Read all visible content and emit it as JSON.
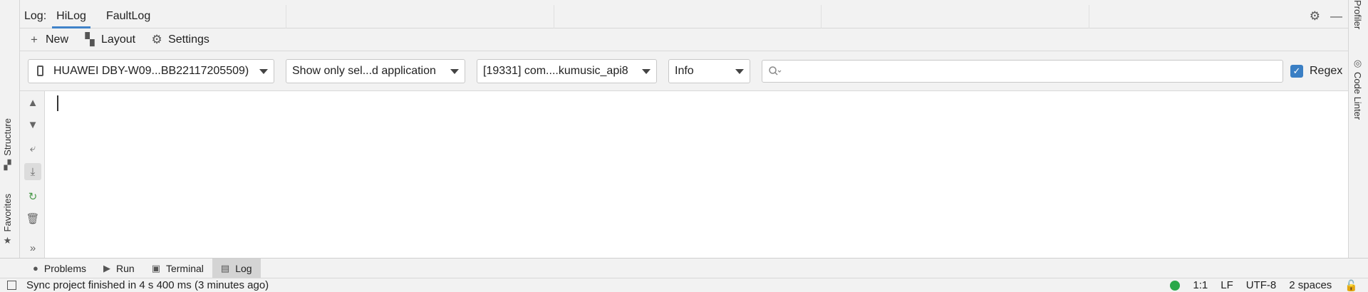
{
  "left_stripe": {
    "structure": "Structure",
    "favorites": "Favorites"
  },
  "right_stripe": {
    "profiler": "Profiler",
    "code_linter": "Code Linter"
  },
  "header": {
    "prefix": "Log:",
    "tabs": [
      {
        "label": "HiLog",
        "active": true
      },
      {
        "label": "FaultLog",
        "active": false
      }
    ]
  },
  "actions": {
    "new": "New",
    "layout": "Layout",
    "settings": "Settings"
  },
  "filters": {
    "device": "HUAWEI DBY-W09...BB22117205509)",
    "app_filter": "Show only sel...d application",
    "process": "[19331] com....kumusic_api8",
    "level": "Info",
    "search_value": "",
    "search_placeholder": "",
    "regex_label": "Regex",
    "regex_checked": true
  },
  "bottom_tabs": [
    {
      "label": "Problems",
      "icon": "problems-icon"
    },
    {
      "label": "Run",
      "icon": "run-icon"
    },
    {
      "label": "Terminal",
      "icon": "terminal-icon"
    },
    {
      "label": "Log",
      "icon": "log-icon",
      "active": true
    }
  ],
  "status": {
    "message": "Sync project finished in 4 s 400 ms (3 minutes ago)",
    "position": "1:1",
    "line_ending": "LF",
    "encoding": "UTF-8",
    "indent": "2 spaces"
  }
}
